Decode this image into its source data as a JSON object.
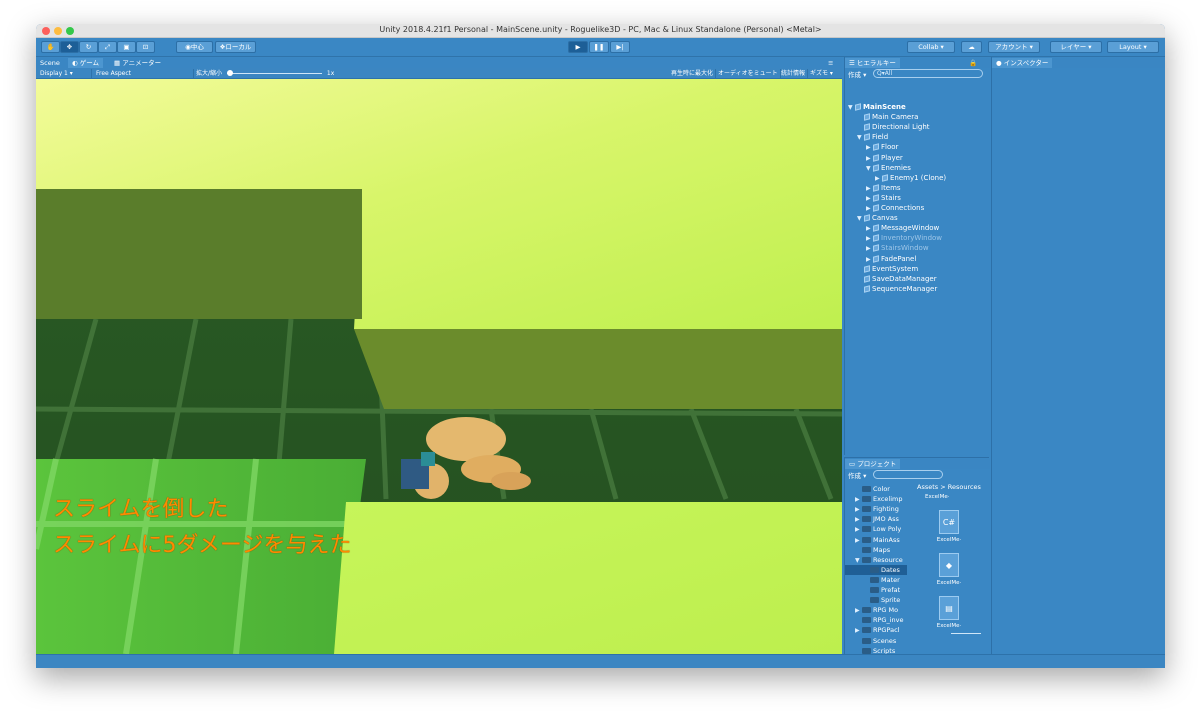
{
  "window": {
    "title": "Unity 2018.4.21f1 Personal - MainScene.unity - Roguelike3D - PC, Mac & Linux Standalone (Personal) <Metal>"
  },
  "toolbar": {
    "pivot_label": "中心",
    "space_label": "ローカル",
    "collab_label": "Collab ▾",
    "account_label": "アカウント ▾",
    "layers_label": "レイヤー ▾",
    "layout_label": "Layout ▾"
  },
  "game_panel": {
    "tabs": [
      "Scene",
      "ゲーム",
      "アニメーター"
    ],
    "display": "Display 1",
    "aspect": "Free Aspect",
    "scale_label": "拡大/縮小",
    "scale_value": "1x",
    "maximize_on_play": "再生時に最大化",
    "mute_audio": "オーディオをミュート",
    "stats": "統計情報",
    "gizmos": "ギズモ",
    "messages": [
      "スライムを倒した",
      "スライムに5ダメージを与えた"
    ]
  },
  "hierarchy": {
    "tab": "ヒエラルキー",
    "create": "作成 ▾",
    "search_placeholder": "Q▾All",
    "items": [
      {
        "label": "MainScene",
        "depth": 0,
        "arrow": "▼",
        "icon": "unity-scene-icon"
      },
      {
        "label": "Main Camera",
        "depth": 1,
        "arrow": "",
        "icon": "cube-icon"
      },
      {
        "label": "Directional Light",
        "depth": 1,
        "arrow": "",
        "icon": "cube-icon"
      },
      {
        "label": "Field",
        "depth": 1,
        "arrow": "▼",
        "icon": "cube-icon"
      },
      {
        "label": "Floor",
        "depth": 2,
        "arrow": "▶",
        "icon": "cube-icon"
      },
      {
        "label": "Player",
        "depth": 2,
        "arrow": "▶",
        "icon": "cube-icon"
      },
      {
        "label": "Enemies",
        "depth": 2,
        "arrow": "▼",
        "icon": "cube-icon"
      },
      {
        "label": "Enemy1 (Clone)",
        "depth": 3,
        "arrow": "▶",
        "icon": "cube-icon"
      },
      {
        "label": "Items",
        "depth": 2,
        "arrow": "▶",
        "icon": "cube-icon"
      },
      {
        "label": "Stairs",
        "depth": 2,
        "arrow": "▶",
        "icon": "cube-icon"
      },
      {
        "label": "Connections",
        "depth": 2,
        "arrow": "▶",
        "icon": "cube-icon"
      },
      {
        "label": "Canvas",
        "depth": 1,
        "arrow": "▼",
        "icon": "cube-icon"
      },
      {
        "label": "MessageWindow",
        "depth": 2,
        "arrow": "▶",
        "icon": "cube-icon"
      },
      {
        "label": "InventoryWindow",
        "depth": 2,
        "arrow": "▶",
        "icon": "inactive-icon",
        "dim": true
      },
      {
        "label": "StairsWindow",
        "depth": 2,
        "arrow": "▶",
        "icon": "inactive-icon",
        "dim": true
      },
      {
        "label": "FadePanel",
        "depth": 2,
        "arrow": "▶",
        "icon": "cube-icon"
      },
      {
        "label": "EventSystem",
        "depth": 1,
        "arrow": "",
        "icon": "cube-icon"
      },
      {
        "label": "SaveDataManager",
        "depth": 1,
        "arrow": "",
        "icon": "cube-icon"
      },
      {
        "label": "SequenceManager",
        "depth": 1,
        "arrow": "",
        "icon": "cube-icon"
      }
    ]
  },
  "project": {
    "tab": "プロジェクト",
    "create": "作成 ▾",
    "breadcrumb": [
      "Assets",
      "Resources"
    ],
    "folders": [
      {
        "label": "Color",
        "depth": 1,
        "arrow": ""
      },
      {
        "label": "Excelimp",
        "depth": 1,
        "arrow": "▶"
      },
      {
        "label": "Fighting",
        "depth": 1,
        "arrow": "▶"
      },
      {
        "label": "JMO Ass",
        "depth": 1,
        "arrow": "▶"
      },
      {
        "label": "Low Poly",
        "depth": 1,
        "arrow": "▶"
      },
      {
        "label": "MainAss",
        "depth": 1,
        "arrow": "▶"
      },
      {
        "label": "Maps",
        "depth": 1,
        "arrow": ""
      },
      {
        "label": "Resource",
        "depth": 1,
        "arrow": "▼"
      },
      {
        "label": "Dates",
        "depth": 2,
        "arrow": "",
        "selected": true
      },
      {
        "label": "Mater",
        "depth": 2,
        "arrow": ""
      },
      {
        "label": "Prefat",
        "depth": 2,
        "arrow": ""
      },
      {
        "label": "Sprite",
        "depth": 2,
        "arrow": ""
      },
      {
        "label": "RPG Mo",
        "depth": 1,
        "arrow": "▶"
      },
      {
        "label": "RPG_inve",
        "depth": 1,
        "arrow": ""
      },
      {
        "label": "RPGPacl",
        "depth": 1,
        "arrow": "▶"
      },
      {
        "label": "Scenes",
        "depth": 1,
        "arrow": ""
      },
      {
        "label": "Scripts",
        "depth": 1,
        "arrow": ""
      },
      {
        "label": "Shaders",
        "depth": 1,
        "arrow": ""
      }
    ],
    "assets": [
      {
        "label": "ExcelMe·",
        "icon": "csharp-script-icon",
        "glyph": "C#"
      },
      {
        "label": "ExcelMe·",
        "icon": "unity-asset-icon",
        "glyph": "◆"
      },
      {
        "label": "ExcelMe·",
        "icon": "file-icon",
        "glyph": "▤"
      }
    ],
    "top_asset_label": "ExcelMe·"
  },
  "inspector": {
    "tab": "インスペクター"
  },
  "colors": {
    "editor_tint": "#3a87c4",
    "message_text": "#ff8a00"
  }
}
